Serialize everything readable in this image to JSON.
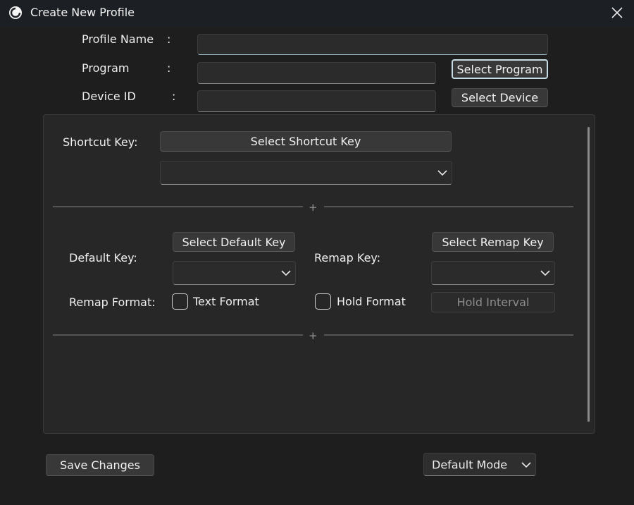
{
  "window": {
    "title": "Create New Profile"
  },
  "form": {
    "profile_name_label": "Profile Name",
    "program_label": "Program",
    "device_id_label": "Device ID",
    "colon": ":",
    "profile_name_value": "",
    "program_value": "",
    "device_id_value": "",
    "select_program_label": "Select Program",
    "select_device_label": "Select Device"
  },
  "shortcut": {
    "label": "Shortcut Key:",
    "select_button_label": "Select Shortcut Key",
    "dropdown_value": ""
  },
  "remap": {
    "default_key_label": "Default Key:",
    "select_default_key_label": "Select Default Key",
    "default_key_dropdown_value": "",
    "remap_key_label": "Remap Key:",
    "select_remap_key_label": "Select Remap Key",
    "remap_key_dropdown_value": "",
    "remap_format_label": "Remap Format:",
    "text_format_label": "Text Format",
    "hold_format_label": "Hold Format",
    "hold_interval_label": "Hold Interval",
    "text_format_checked": false,
    "hold_format_checked": false
  },
  "dividers": {
    "plus_symbol": "+"
  },
  "footer": {
    "save_changes_label": "Save Changes",
    "mode_value": "Default Mode"
  },
  "colors": {
    "background": "#1e1e1e",
    "titlebar": "#1c1f24",
    "panel": "#272727",
    "button": "#383838",
    "field": "#2b2b2b",
    "focus_border": "#c8dde6"
  }
}
